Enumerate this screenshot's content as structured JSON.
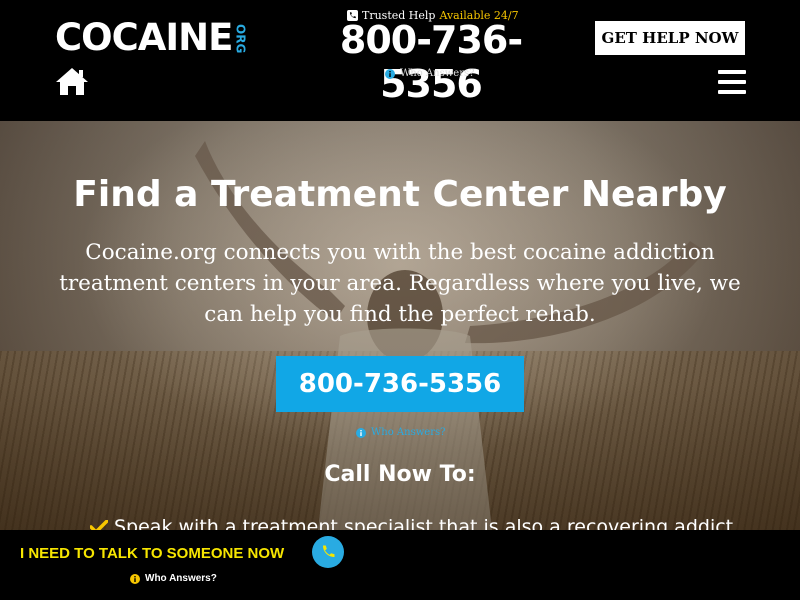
{
  "header": {
    "logo_text": "COCAINE",
    "logo_suffix": "ORG",
    "trusted_label": "Trusted Help",
    "available_label": "Available 24/7",
    "phone": "800-736-5356",
    "who_answers": "Who Answers?",
    "get_help_label": "GET HELP NOW",
    "icons": [
      "home-icon",
      "phone-icon",
      "info-icon",
      "menu-icon"
    ]
  },
  "hero": {
    "title": "Find a Treatment Center Nearby",
    "subtitle": "Cocaine.org connects you with the best cocaine addiction treatment centers in your area. Regardless where you live, we can help you find the perfect rehab.",
    "phone_button": "800-736-5356",
    "who_answers": "Who Answers?",
    "call_now": "Call Now To:",
    "bullets": [
      "Speak with a treatment specialist that is also a recovering addict"
    ]
  },
  "bottom_bar": {
    "cta": "I NEED TO TALK TO SOMEONE NOW",
    "who_answers": "Who Answers?"
  },
  "colors": {
    "accent_blue": "#11a7e6",
    "accent_yellow": "#f7c600",
    "cta_yellow": "#f7e600",
    "header_bg": "#000000"
  }
}
